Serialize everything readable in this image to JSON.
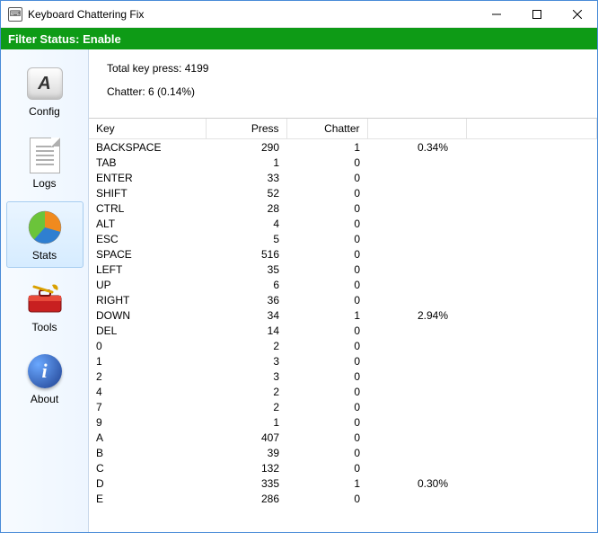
{
  "window": {
    "title": "Keyboard Chattering Fix"
  },
  "status": {
    "label": "Filter Status:",
    "value": "Enable"
  },
  "sidebar": {
    "items": [
      {
        "id": "config",
        "label": "Config"
      },
      {
        "id": "logs",
        "label": "Logs"
      },
      {
        "id": "stats",
        "label": "Stats"
      },
      {
        "id": "tools",
        "label": "Tools"
      },
      {
        "id": "about",
        "label": "About"
      }
    ],
    "selected": "stats"
  },
  "summary": {
    "total_label": "Total key press:",
    "total_value": "4199",
    "chatter_label": "Chatter:",
    "chatter_value": "6 (0.14%)"
  },
  "columns": {
    "key": "Key",
    "press": "Press",
    "chatter": "Chatter",
    "pct": ""
  },
  "rows": [
    {
      "key": "BACKSPACE",
      "press": 290,
      "chatter": 1,
      "pct": "0.34%"
    },
    {
      "key": "TAB",
      "press": 1,
      "chatter": 0,
      "pct": ""
    },
    {
      "key": "ENTER",
      "press": 33,
      "chatter": 0,
      "pct": ""
    },
    {
      "key": "SHIFT",
      "press": 52,
      "chatter": 0,
      "pct": ""
    },
    {
      "key": "CTRL",
      "press": 28,
      "chatter": 0,
      "pct": ""
    },
    {
      "key": "ALT",
      "press": 4,
      "chatter": 0,
      "pct": ""
    },
    {
      "key": "ESC",
      "press": 5,
      "chatter": 0,
      "pct": ""
    },
    {
      "key": "SPACE",
      "press": 516,
      "chatter": 0,
      "pct": ""
    },
    {
      "key": "LEFT",
      "press": 35,
      "chatter": 0,
      "pct": ""
    },
    {
      "key": "UP",
      "press": 6,
      "chatter": 0,
      "pct": ""
    },
    {
      "key": "RIGHT",
      "press": 36,
      "chatter": 0,
      "pct": ""
    },
    {
      "key": "DOWN",
      "press": 34,
      "chatter": 1,
      "pct": "2.94%"
    },
    {
      "key": "DEL",
      "press": 14,
      "chatter": 0,
      "pct": ""
    },
    {
      "key": "0",
      "press": 2,
      "chatter": 0,
      "pct": ""
    },
    {
      "key": "1",
      "press": 3,
      "chatter": 0,
      "pct": ""
    },
    {
      "key": "2",
      "press": 3,
      "chatter": 0,
      "pct": ""
    },
    {
      "key": "4",
      "press": 2,
      "chatter": 0,
      "pct": ""
    },
    {
      "key": "7",
      "press": 2,
      "chatter": 0,
      "pct": ""
    },
    {
      "key": "9",
      "press": 1,
      "chatter": 0,
      "pct": ""
    },
    {
      "key": "A",
      "press": 407,
      "chatter": 0,
      "pct": ""
    },
    {
      "key": "B",
      "press": 39,
      "chatter": 0,
      "pct": ""
    },
    {
      "key": "C",
      "press": 132,
      "chatter": 0,
      "pct": ""
    },
    {
      "key": "D",
      "press": 335,
      "chatter": 1,
      "pct": "0.30%"
    },
    {
      "key": "E",
      "press": 286,
      "chatter": 0,
      "pct": ""
    }
  ]
}
